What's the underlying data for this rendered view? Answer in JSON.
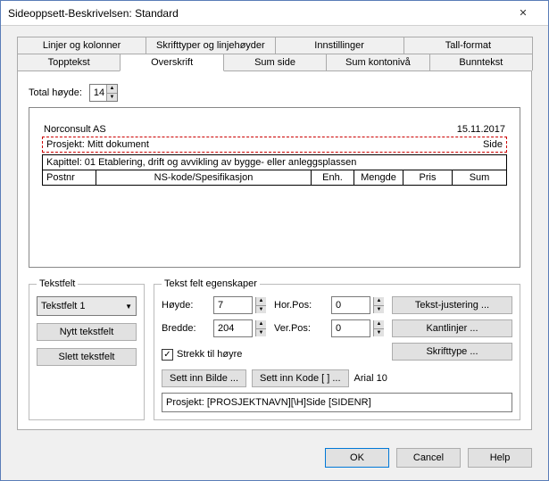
{
  "window": {
    "title": "Sideoppsett-Beskrivelsen: Standard"
  },
  "tabs_top": {
    "t1": "Linjer og kolonner",
    "t2": "Skrifttyper og linjehøyder",
    "t3": "Innstillinger",
    "t4": "Tall-format"
  },
  "tabs_bottom": {
    "t1": "Topptekst",
    "t2": "Overskrift",
    "t3": "Sum side",
    "t4": "Sum kontonivå",
    "t5": "Bunntekst"
  },
  "total_height": {
    "label": "Total høyde:",
    "value": "14"
  },
  "preview": {
    "company": "Norconsult AS",
    "date": "15.11.2017",
    "project_label": "Prosjekt: Mitt dokument",
    "side_label": "Side",
    "chapter": "Kapittel: 01 Etablering, drift og avvikling av bygge- eller anleggsplassen",
    "cols": {
      "c1": "Postnr",
      "c2": "NS-kode/Spesifikasjon",
      "c3": "Enh.",
      "c4": "Mengde",
      "c5": "Pris",
      "c6": "Sum"
    }
  },
  "tekstfelt": {
    "legend": "Tekstfelt",
    "selected": "Tekstfelt 1",
    "new_btn": "Nytt tekstfelt",
    "del_btn": "Slett tekstfelt"
  },
  "props": {
    "legend": "Tekst felt egenskaper",
    "hoyde_label": "Høyde:",
    "hoyde_val": "7",
    "bredde_label": "Bredde:",
    "bredde_val": "204",
    "horpos_label": "Hor.Pos:",
    "horpos_val": "0",
    "verpos_label": "Ver.Pos:",
    "verpos_val": "0",
    "tekstjust_btn": "Tekst-justering ...",
    "kantlinjer_btn": "Kantlinjer ...",
    "skrifttype_btn": "Skrifttype ...",
    "strekk_label": "Strekk til høyre",
    "sett_bilde_btn": "Sett inn Bilde ...",
    "sett_kode_btn": "Sett inn Kode [ ] ...",
    "font_info": "Arial 10",
    "field_text": "Prosjekt: [PROSJEKTNAVN][\\H]Side [SIDENR]"
  },
  "footer": {
    "ok": "OK",
    "cancel": "Cancel",
    "help": "Help"
  }
}
